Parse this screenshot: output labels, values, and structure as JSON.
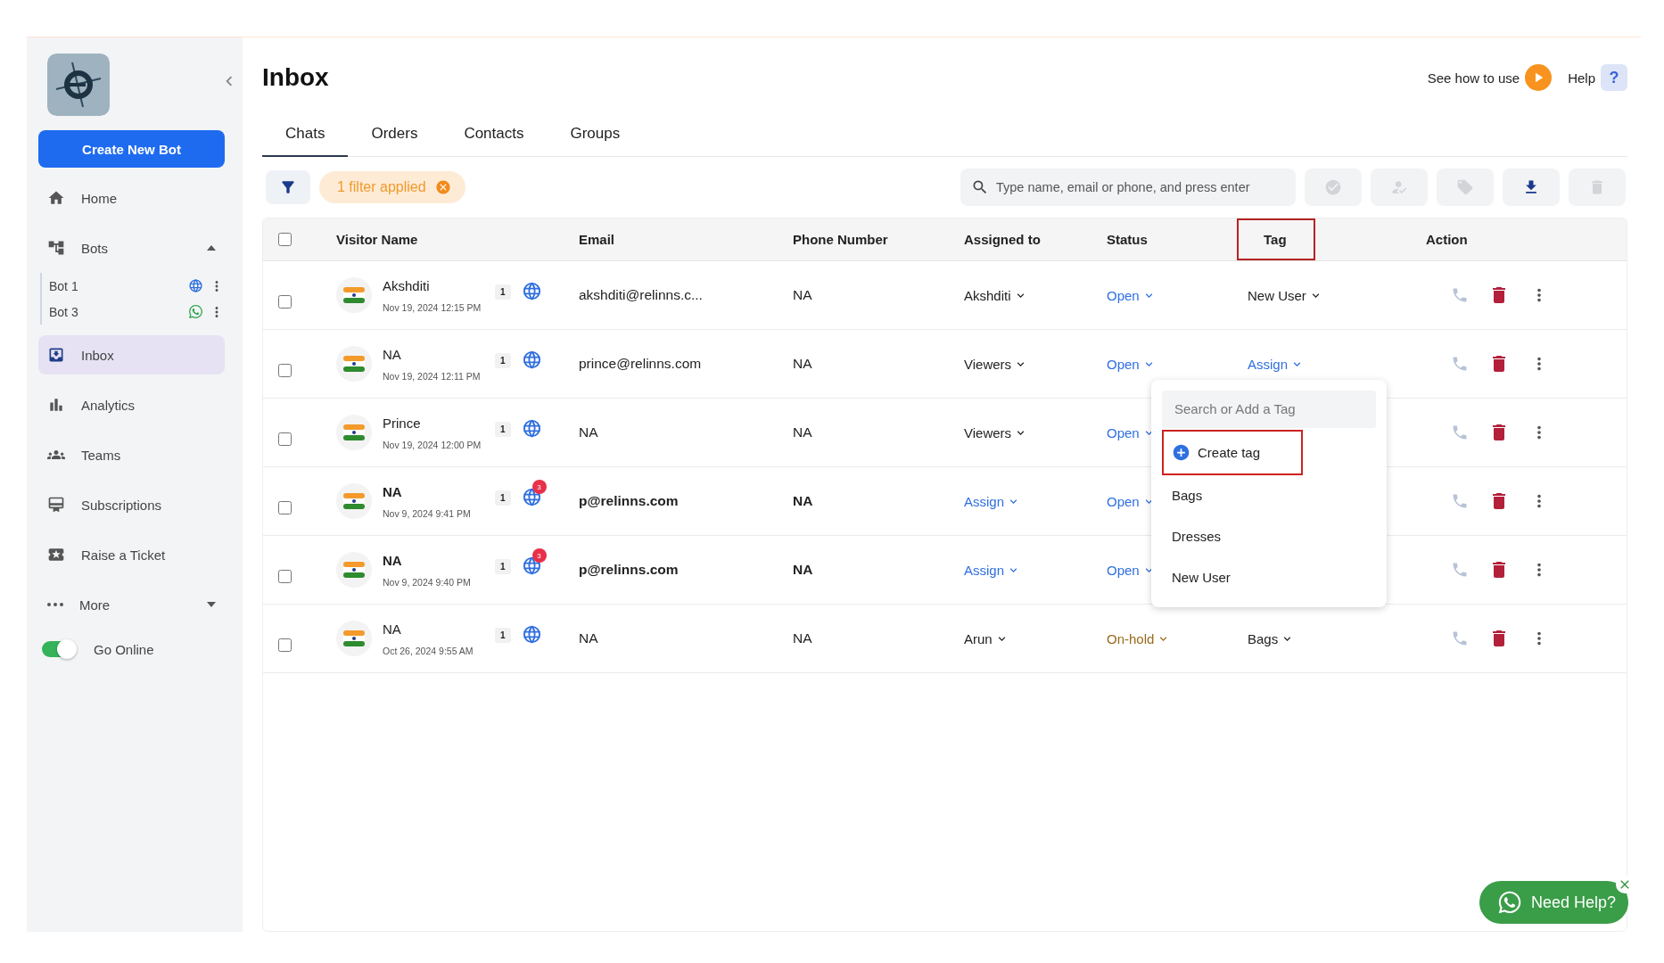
{
  "sidebar": {
    "create_button": "Create New Bot",
    "items": [
      {
        "kind": "home",
        "label": "Home",
        "selected": false
      },
      {
        "kind": "bots",
        "label": "Bots",
        "selected": false,
        "expanded": true,
        "children": [
          {
            "label": "Bot 1",
            "kind": "web"
          },
          {
            "label": "Bot 3",
            "kind": "whatsapp"
          }
        ]
      },
      {
        "kind": "inbox",
        "label": "Inbox",
        "selected": true
      },
      {
        "kind": "analytics",
        "label": "Analytics",
        "selected": false
      },
      {
        "kind": "teams",
        "label": "Teams",
        "selected": false
      },
      {
        "kind": "subscriptions",
        "label": "Subscriptions",
        "selected": false
      },
      {
        "kind": "ticket",
        "label": "Raise a Ticket",
        "selected": false
      },
      {
        "kind": "more",
        "label": "More",
        "selected": false,
        "expanded": false
      }
    ],
    "online": {
      "label": "Go Online",
      "on": true
    }
  },
  "header": {
    "title": "Inbox",
    "how_to": "See how to use",
    "help": "Help",
    "help_icon": "?"
  },
  "tabs": [
    {
      "label": "Chats",
      "selected": true
    },
    {
      "label": "Orders",
      "selected": false
    },
    {
      "label": "Contacts",
      "selected": false
    },
    {
      "label": "Groups",
      "selected": false
    }
  ],
  "toolbar": {
    "filter_chip": "1 filter applied",
    "search": {
      "placeholder": "Type name, email or phone, and press enter"
    },
    "actions": [
      {
        "kind": "resolve",
        "disabled": true
      },
      {
        "kind": "assign",
        "disabled": true
      },
      {
        "kind": "tag",
        "disabled": true
      },
      {
        "kind": "download",
        "disabled": false
      },
      {
        "kind": "delete",
        "disabled": true
      }
    ]
  },
  "table": {
    "select_all_checked": false,
    "columns": [
      {
        "label": "Visitor Name",
        "highlighted": false
      },
      {
        "label": "Email",
        "highlighted": false
      },
      {
        "label": "Phone Number",
        "highlighted": false
      },
      {
        "label": "Assigned to",
        "highlighted": false
      },
      {
        "label": "Status",
        "highlighted": false
      },
      {
        "label": "Tag",
        "highlighted": true
      },
      {
        "label": "Action",
        "highlighted": false
      }
    ],
    "rows": [
      {
        "checked": false,
        "unread": false,
        "name": "Akshditi",
        "time": "Nov 19, 2024 12:15 PM",
        "count": "1",
        "email": "akshditi@relinns.c...",
        "phone": "NA",
        "assigned": {
          "text": "Akshditi",
          "set": true
        },
        "status": {
          "text": "Open",
          "kind": "open"
        },
        "tag": {
          "text": "New User",
          "set": true,
          "menu_open": false
        }
      },
      {
        "checked": false,
        "unread": false,
        "name": "NA",
        "time": "Nov 19, 2024 12:11 PM",
        "count": "1",
        "email": "prince@relinns.com",
        "phone": "NA",
        "assigned": {
          "text": "Viewers",
          "set": true
        },
        "status": {
          "text": "Open",
          "kind": "open"
        },
        "tag": {
          "text": "Assign",
          "set": false,
          "menu_open": true
        }
      },
      {
        "checked": false,
        "unread": false,
        "name": "Prince",
        "time": "Nov 19, 2024 12:00 PM",
        "count": "1",
        "email": "NA",
        "phone": "NA",
        "assigned": {
          "text": "Viewers",
          "set": true
        },
        "status": {
          "text": "Open",
          "kind": "open"
        }
      },
      {
        "checked": false,
        "unread": true,
        "badge": "3",
        "name": "NA",
        "time": "Nov 9, 2024 9:41 PM",
        "count": "1",
        "email": "p@relinns.com",
        "phone": "NA",
        "assigned": {
          "text": "Assign",
          "set": false
        },
        "status": {
          "text": "Open",
          "kind": "open"
        }
      },
      {
        "checked": false,
        "unread": true,
        "badge": "3",
        "name": "NA",
        "time": "Nov 9, 2024 9:40 PM",
        "count": "1",
        "email": "p@relinns.com",
        "phone": "NA",
        "assigned": {
          "text": "Assign",
          "set": false
        },
        "status": {
          "text": "Open",
          "kind": "open"
        }
      },
      {
        "checked": false,
        "unread": false,
        "name": "NA",
        "time": "Oct 26, 2024 9:55 AM",
        "count": "1",
        "email": "NA",
        "phone": "NA",
        "assigned": {
          "text": "Arun",
          "set": true
        },
        "status": {
          "text": "On-hold",
          "kind": "onhold"
        },
        "tag": {
          "text": "Bags",
          "set": true,
          "menu_open": false
        }
      }
    ]
  },
  "tag_menu": {
    "placeholder": "Search or Add a Tag",
    "create_label": "Create tag",
    "create_highlighted": true,
    "options": [
      "Bags",
      "Dresses",
      "New User"
    ]
  },
  "help_widget": {
    "label": "Need Help?"
  }
}
